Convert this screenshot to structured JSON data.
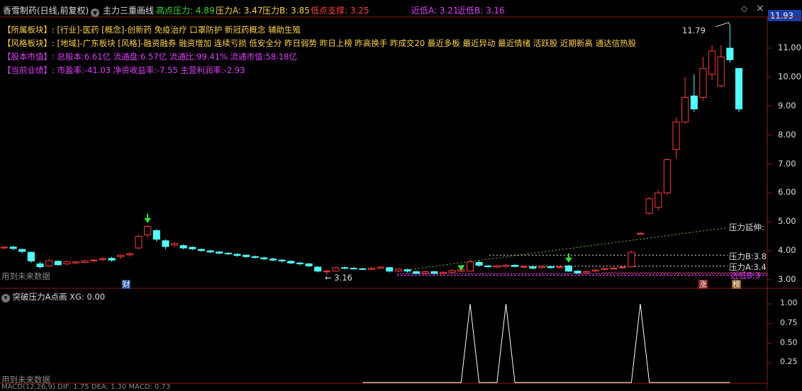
{
  "header": {
    "stock_title": "香雪制药(日线,前复权)",
    "indicator_name": "主力三重画线",
    "high_pressure_label": "高点压力: 4.89",
    "pressure_a_label": "压力A: 3.47",
    "pressure_b_label": "压力B: 3.85",
    "low_support_label": "低点支撑: 3.25",
    "recent_low_a_label": "近低A: 3.21",
    "recent_low_b_label": "近低B: 3.16",
    "current_price": "11.93",
    "diamond_icon": "diamond-icon",
    "close_icon": "close-icon",
    "arrow_icon": "circle-arrow-icon"
  },
  "info": {
    "row1_tag": "【所属板块】:",
    "row1_text": "[行业]-医药 [概念]-创新药 免疫治疗 口罩防护 新冠药概念 辅助生殖",
    "row2_tag": "【风格板块】:",
    "row2_text": "[地域]-广东板块 [风格]-融资融券 融资增加 连续亏损 低安全分 昨日弱势 昨日上榜 昨高换手 昨成交20 最近多板 最近异动 最近情绪 活跃股 近期新高 通达信热股",
    "row3_tag": "【股本市值】:",
    "row3_text": "总股本:6.61亿 流通盘:6.57亿 流通比:99.41% 流通市值:58.18亿",
    "row4_tag": "【当前业绩】:",
    "row4_text": "市盈率:-41.03 净资收益率:-7.55 主营利润率:-2.93"
  },
  "price_axis": {
    "ticks": [
      "11.00",
      "10.00",
      "9.00",
      "8.00",
      "7.00",
      "6.00",
      "5.00",
      "4.00",
      "3.00"
    ]
  },
  "main_chart": {
    "future_data_note": "用到未来数据",
    "high_marker": "11.79",
    "low_marker": "3.16",
    "pressure_extend_label": "压力延伸:",
    "pressure_b_line_label": "压力B:3.8",
    "pressure_a_line_label": "压力A:3.4",
    "recent_low_line_label": "近低B:3",
    "badge_cai": "财",
    "badge_zhang": "涨",
    "badge_bang": "榜"
  },
  "sub_chart": {
    "title": "突破压力A点画 XG: 0.00",
    "future_data_note": "用到未来数据",
    "ticks": [
      "1.00",
      "0.75",
      "0.50",
      "0.25"
    ],
    "bottom_text": "MACD(12,26,9) DIF: 1.75 DEA: 1.30 MACD: 0.73"
  },
  "chart_data": {
    "type": "candlestick",
    "ylim": [
      2.9,
      12.2
    ],
    "candles": [
      {
        "o": 4.1,
        "c": 4.13,
        "h": 4.16,
        "l": 4.05
      },
      {
        "o": 4.13,
        "c": 4.08,
        "h": 4.18,
        "l": 4.03
      },
      {
        "o": 4.05,
        "c": 3.98,
        "h": 4.08,
        "l": 3.92
      },
      {
        "o": 3.95,
        "c": 3.65,
        "h": 3.98,
        "l": 3.58
      },
      {
        "o": 3.55,
        "c": 3.45,
        "h": 3.62,
        "l": 3.4
      },
      {
        "o": 3.48,
        "c": 3.66,
        "h": 3.7,
        "l": 3.44
      },
      {
        "o": 3.64,
        "c": 3.52,
        "h": 3.67,
        "l": 3.48
      },
      {
        "o": 3.55,
        "c": 3.62,
        "h": 3.66,
        "l": 3.5
      },
      {
        "o": 3.58,
        "c": 3.62,
        "h": 3.66,
        "l": 3.55
      },
      {
        "o": 3.6,
        "c": 3.65,
        "h": 3.68,
        "l": 3.57
      },
      {
        "o": 3.66,
        "c": 3.68,
        "h": 3.72,
        "l": 3.6
      },
      {
        "o": 3.7,
        "c": 3.73,
        "h": 3.78,
        "l": 3.64
      },
      {
        "o": 3.74,
        "c": 3.68,
        "h": 3.8,
        "l": 3.62
      },
      {
        "o": 3.8,
        "c": 3.85,
        "h": 3.88,
        "l": 3.72
      },
      {
        "o": 3.86,
        "c": 3.9,
        "h": 3.95,
        "l": 3.8
      },
      {
        "o": 4.1,
        "c": 4.5,
        "h": 4.55,
        "l": 4.05
      },
      {
        "o": 4.55,
        "c": 4.85,
        "h": 4.89,
        "l": 4.45
      },
      {
        "o": 4.7,
        "c": 4.4,
        "h": 4.75,
        "l": 4.32
      },
      {
        "o": 4.35,
        "c": 4.15,
        "h": 4.4,
        "l": 4.05
      },
      {
        "o": 4.2,
        "c": 4.25,
        "h": 4.3,
        "l": 4.12
      },
      {
        "o": 4.18,
        "c": 4.1,
        "h": 4.22,
        "l": 4.05
      },
      {
        "o": 4.12,
        "c": 4.07,
        "h": 4.16,
        "l": 4.02
      },
      {
        "o": 4.05,
        "c": 4.01,
        "h": 4.08,
        "l": 3.97
      },
      {
        "o": 4.0,
        "c": 3.96,
        "h": 4.04,
        "l": 3.92
      },
      {
        "o": 3.96,
        "c": 3.92,
        "h": 3.99,
        "l": 3.88
      },
      {
        "o": 3.92,
        "c": 3.9,
        "h": 3.95,
        "l": 3.85
      },
      {
        "o": 3.88,
        "c": 3.84,
        "h": 3.92,
        "l": 3.8
      },
      {
        "o": 3.85,
        "c": 3.8,
        "h": 3.88,
        "l": 3.76
      },
      {
        "o": 3.8,
        "c": 3.77,
        "h": 3.84,
        "l": 3.73
      },
      {
        "o": 3.76,
        "c": 3.72,
        "h": 3.8,
        "l": 3.68
      },
      {
        "o": 3.72,
        "c": 3.68,
        "h": 3.76,
        "l": 3.64
      },
      {
        "o": 3.68,
        "c": 3.65,
        "h": 3.71,
        "l": 3.6
      },
      {
        "o": 3.64,
        "c": 3.58,
        "h": 3.67,
        "l": 3.54
      },
      {
        "o": 3.58,
        "c": 3.55,
        "h": 3.62,
        "l": 3.5
      },
      {
        "o": 3.55,
        "c": 3.48,
        "h": 3.58,
        "l": 3.44
      },
      {
        "o": 3.44,
        "c": 3.3,
        "h": 3.47,
        "l": 3.25
      },
      {
        "o": 3.3,
        "c": 3.3,
        "h": 3.34,
        "l": 3.16
      },
      {
        "o": 3.3,
        "c": 3.42,
        "h": 3.45,
        "l": 3.28
      },
      {
        "o": 3.42,
        "c": 3.4,
        "h": 3.46,
        "l": 3.36
      },
      {
        "o": 3.4,
        "c": 3.38,
        "h": 3.43,
        "l": 3.35
      },
      {
        "o": 3.38,
        "c": 3.36,
        "h": 3.41,
        "l": 3.34
      },
      {
        "o": 3.36,
        "c": 3.4,
        "h": 3.43,
        "l": 3.33
      },
      {
        "o": 3.4,
        "c": 3.44,
        "h": 3.47,
        "l": 3.38
      },
      {
        "o": 3.42,
        "c": 3.3,
        "h": 3.45,
        "l": 3.25
      },
      {
        "o": 3.3,
        "c": 3.37,
        "h": 3.4,
        "l": 3.26
      },
      {
        "o": 3.35,
        "c": 3.3,
        "h": 3.38,
        "l": 3.24
      },
      {
        "o": 3.28,
        "c": 3.22,
        "h": 3.31,
        "l": 3.21
      },
      {
        "o": 3.23,
        "c": 3.28,
        "h": 3.31,
        "l": 3.2
      },
      {
        "o": 3.28,
        "c": 3.22,
        "h": 3.3,
        "l": 3.18
      },
      {
        "o": 3.22,
        "c": 3.26,
        "h": 3.29,
        "l": 3.19
      },
      {
        "o": 3.26,
        "c": 3.32,
        "h": 3.36,
        "l": 3.23
      },
      {
        "o": 3.3,
        "c": 3.35,
        "h": 3.4,
        "l": 3.26
      },
      {
        "o": 3.3,
        "c": 3.62,
        "h": 3.7,
        "l": 3.28
      },
      {
        "o": 3.6,
        "c": 3.5,
        "h": 3.66,
        "l": 3.45
      },
      {
        "o": 3.48,
        "c": 3.45,
        "h": 3.52,
        "l": 3.42
      },
      {
        "o": 3.44,
        "c": 3.48,
        "h": 3.52,
        "l": 3.4
      },
      {
        "o": 3.46,
        "c": 3.5,
        "h": 3.54,
        "l": 3.42
      },
      {
        "o": 3.5,
        "c": 3.46,
        "h": 3.55,
        "l": 3.43
      },
      {
        "o": 3.44,
        "c": 3.46,
        "h": 3.5,
        "l": 3.4
      },
      {
        "o": 3.45,
        "c": 3.4,
        "h": 3.48,
        "l": 3.37
      },
      {
        "o": 3.42,
        "c": 3.46,
        "h": 3.5,
        "l": 3.38
      },
      {
        "o": 3.45,
        "c": 3.42,
        "h": 3.49,
        "l": 3.38
      },
      {
        "o": 3.42,
        "c": 3.45,
        "h": 3.49,
        "l": 3.38
      },
      {
        "o": 3.48,
        "c": 3.3,
        "h": 3.52,
        "l": 3.27
      },
      {
        "o": 3.3,
        "c": 3.24,
        "h": 3.33,
        "l": 3.2
      },
      {
        "o": 3.24,
        "c": 3.28,
        "h": 3.31,
        "l": 3.21
      },
      {
        "o": 3.3,
        "c": 3.34,
        "h": 3.38,
        "l": 3.26
      },
      {
        "o": 3.36,
        "c": 3.39,
        "h": 3.42,
        "l": 3.33
      },
      {
        "o": 3.4,
        "c": 3.4,
        "h": 3.44,
        "l": 3.36
      },
      {
        "o": 3.42,
        "c": 3.44,
        "h": 3.48,
        "l": 3.38
      },
      {
        "o": 3.45,
        "c": 3.95,
        "h": 4.0,
        "l": 3.43
      },
      {
        "o": 4.6,
        "c": 4.6,
        "h": 4.65,
        "l": 4.58
      },
      {
        "o": 5.3,
        "c": 5.8,
        "h": 5.85,
        "l": 5.25
      },
      {
        "o": 5.5,
        "c": 6.0,
        "h": 6.1,
        "l": 5.4
      },
      {
        "o": 6.0,
        "c": 7.15,
        "h": 7.2,
        "l": 5.95
      },
      {
        "o": 7.5,
        "c": 8.45,
        "h": 8.6,
        "l": 7.2
      },
      {
        "o": 8.45,
        "c": 9.3,
        "h": 10.0,
        "l": 8.4
      },
      {
        "o": 9.35,
        "c": 8.9,
        "h": 10.1,
        "l": 8.8
      },
      {
        "o": 9.3,
        "c": 10.3,
        "h": 10.7,
        "l": 9.2
      },
      {
        "o": 10.1,
        "c": 10.9,
        "h": 11.1,
        "l": 9.9
      },
      {
        "o": 9.7,
        "c": 10.7,
        "h": 11.1,
        "l": 9.65
      },
      {
        "o": 11.0,
        "c": 10.6,
        "h": 11.79,
        "l": 10.5
      },
      {
        "o": 10.3,
        "c": 8.9,
        "h": 10.3,
        "l": 8.8
      }
    ],
    "signals": [
      0,
      0,
      0,
      0,
      0,
      0,
      0,
      0,
      0,
      0,
      0,
      0,
      0,
      0,
      0,
      0,
      0,
      0,
      0,
      0,
      0,
      0,
      0,
      0,
      0,
      0,
      0,
      0,
      0,
      0,
      0,
      0,
      0,
      0,
      0,
      0,
      0,
      0,
      0,
      0,
      0,
      0,
      0,
      0,
      0,
      0,
      0,
      0,
      0,
      0,
      0,
      0,
      1,
      0,
      0,
      0,
      1,
      0,
      0,
      0,
      0,
      0,
      0,
      0,
      0,
      0,
      0,
      0,
      0,
      0,
      0,
      1,
      0,
      0,
      0,
      0,
      0,
      0,
      0,
      0,
      0,
      0,
      0,
      0
    ]
  }
}
